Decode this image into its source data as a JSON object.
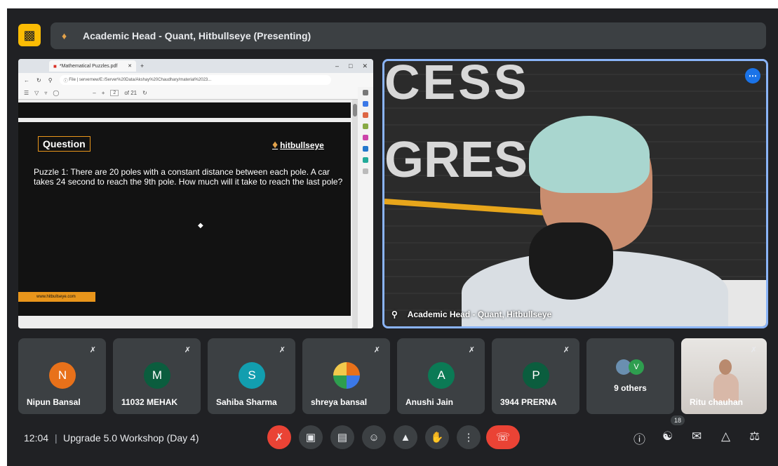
{
  "presenter_bar": {
    "title": "Academic Head - Quant, Hitbullseye (Presenting)"
  },
  "shared_screen": {
    "tab_title": "*Mathematical Puzzles.pdf",
    "url": "servernew/E:/Server%20Data/Akshay%20Chaudhary/material%2023...",
    "url_prefix": "File",
    "page_number": "2",
    "page_total": "of 21",
    "slide": {
      "label": "Question",
      "brand": "hitbullseye",
      "puzzle_text": "Puzzle 1: There are 20 poles with a constant distance between each pole. A car takes 24 second to reach the 9th pole. How much will it take to reach the last pole?",
      "website": "www.hitbullseye.com"
    }
  },
  "speaker": {
    "name": "Academic Head - Quant, Hitbullseye",
    "wall_text_1": "CESS",
    "wall_text_2": "GRESS"
  },
  "participants": [
    {
      "initial": "N",
      "name": "Nipun Bansal",
      "color": "#e8711a"
    },
    {
      "initial": "M",
      "name": "11032 MEHAK",
      "color": "#0b5d3e"
    },
    {
      "initial": "S",
      "name": "Sahiba Sharma",
      "color": "#129eaf"
    },
    {
      "initial": "",
      "name": "shreya bansal",
      "color": "#c97a3c"
    },
    {
      "initial": "A",
      "name": "Anushi Jain",
      "color": "#0b7a55"
    },
    {
      "initial": "P",
      "name": "3944 PRERNA",
      "color": "#0b5d3e"
    }
  ],
  "others": {
    "label": "9 others",
    "initial": "V",
    "color": "#2e9e4f"
  },
  "ritu": {
    "name": "Ritu chauhan"
  },
  "controls": {
    "time": "12:04",
    "meeting_title": "Upgrade 5.0 Workshop (Day 4)",
    "participant_count": "18"
  }
}
